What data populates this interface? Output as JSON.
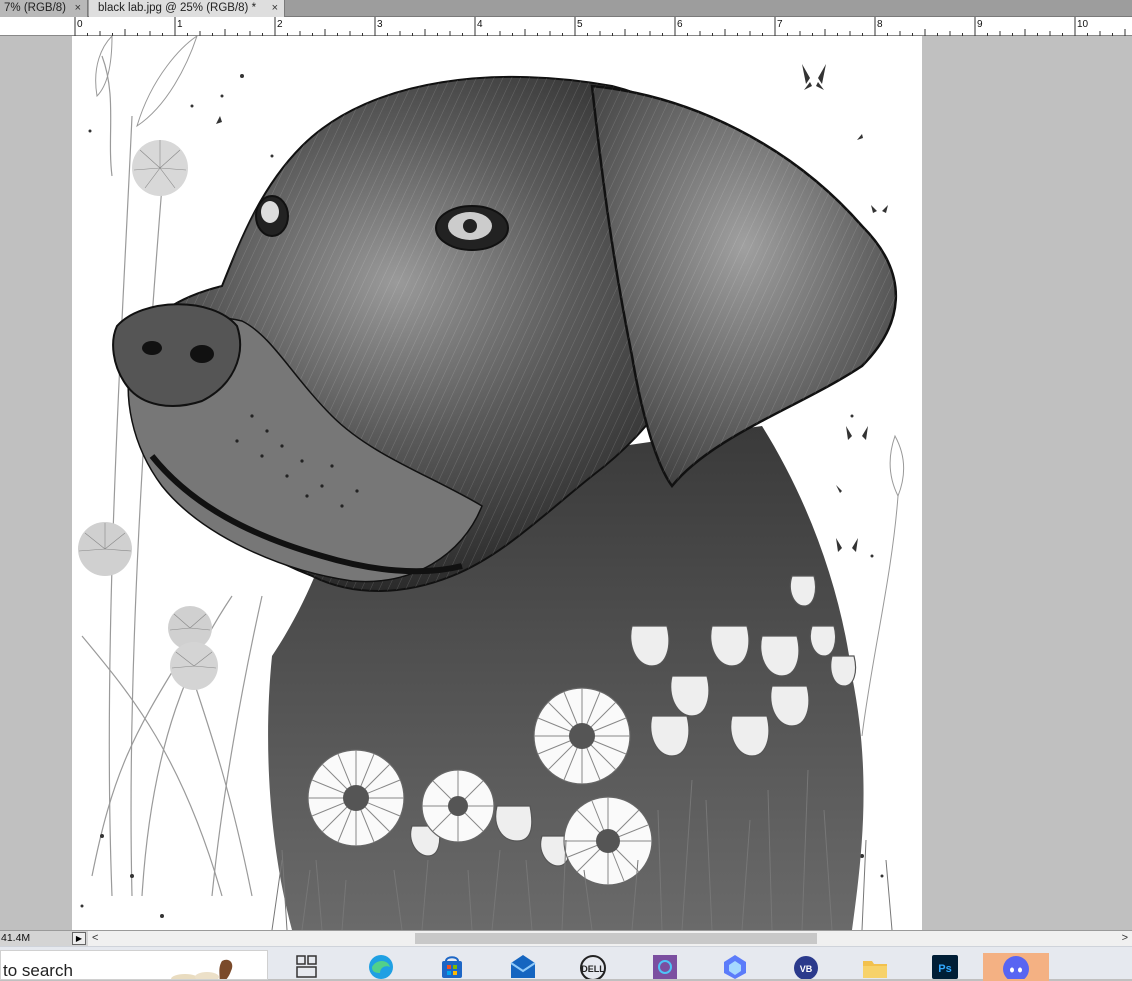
{
  "tabs": [
    {
      "label": "7% (RGB/8)",
      "close": "×",
      "active": false
    },
    {
      "label": "black lab.jpg @ 25% (RGB/8) *",
      "close": "×",
      "active": true
    }
  ],
  "ruler": {
    "labels": [
      "0",
      "1",
      "2",
      "3",
      "4",
      "5",
      "6",
      "7",
      "8",
      "9",
      "10"
    ]
  },
  "document": {
    "description_icon": "image-canvas"
  },
  "statusbar": {
    "zoom": "41.4M",
    "menu_arrow": "▶",
    "scroll_left": "<",
    "scroll_right": ">"
  },
  "taskbar": {
    "search_placeholder": "to search",
    "icons": [
      {
        "name": "task-view-icon"
      },
      {
        "name": "edge-icon"
      },
      {
        "name": "store-icon"
      },
      {
        "name": "mail-icon"
      },
      {
        "name": "dell-icon"
      },
      {
        "name": "app-icon"
      },
      {
        "name": "copilot-icon"
      },
      {
        "name": "vpn-icon"
      },
      {
        "name": "file-explorer-icon"
      },
      {
        "name": "photoshop-icon"
      },
      {
        "name": "discord-icon"
      }
    ]
  },
  "colors": {
    "workspace": "#c0c0c0",
    "taskbar": "#e6e9ef",
    "highlight": "#f4b183",
    "photoshop": "#31a8ff"
  }
}
